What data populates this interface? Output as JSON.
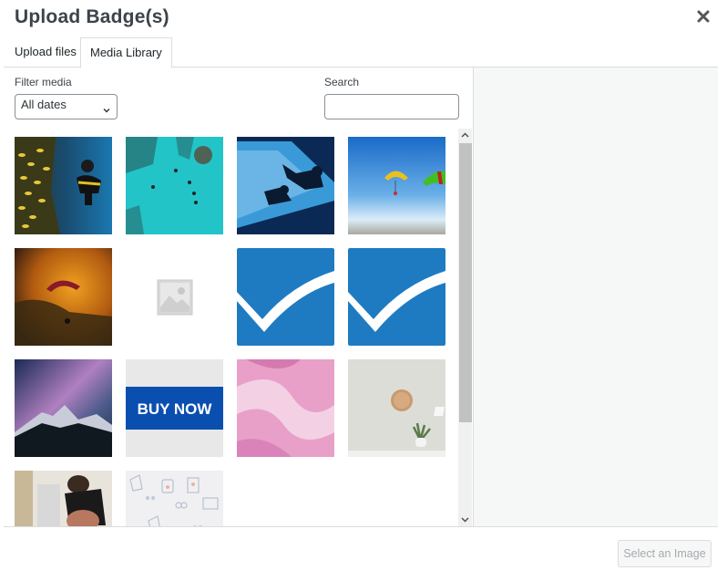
{
  "modal": {
    "title": "Upload Badge(s)",
    "close_icon": "close-icon"
  },
  "tabs": [
    {
      "label": "Upload files",
      "active": false
    },
    {
      "label": "Media Library",
      "active": true
    }
  ],
  "toolbar": {
    "filter_label": "Filter media",
    "filter_selected": "All dates",
    "search_label": "Search",
    "search_value": "",
    "search_placeholder": ""
  },
  "media": [
    {
      "name": "scuba-diver-with-fish",
      "kind": "photo"
    },
    {
      "name": "snorkelers-turquoise-reef",
      "kind": "photo"
    },
    {
      "name": "divers-silhouette-underwater",
      "kind": "photo"
    },
    {
      "name": "paragliders-blue-sky",
      "kind": "photo"
    },
    {
      "name": "paraglider-sunset",
      "kind": "photo"
    },
    {
      "name": "image-placeholder",
      "kind": "placeholder"
    },
    {
      "name": "blue-checkmark-badge",
      "kind": "logo"
    },
    {
      "name": "blue-checkmark-badge",
      "kind": "logo"
    },
    {
      "name": "milky-way-mountains",
      "kind": "photo"
    },
    {
      "name": "buy-now-banner",
      "kind": "banner",
      "text": "BUY NOW"
    },
    {
      "name": "pink-marble-texture",
      "kind": "photo"
    },
    {
      "name": "clock-plant-lamp",
      "kind": "photo"
    },
    {
      "name": "athlete-stretching",
      "kind": "photo"
    },
    {
      "name": "doodle-icons-pattern",
      "kind": "pattern"
    }
  ],
  "footer": {
    "select_button": "Select an Image",
    "select_button_disabled": true
  },
  "colors": {
    "badge_blue": "#1e7bc1",
    "buy_now_blue": "#0a4fb0",
    "sidebar_bg": "#f6f7f7",
    "border": "#dcdcde"
  }
}
